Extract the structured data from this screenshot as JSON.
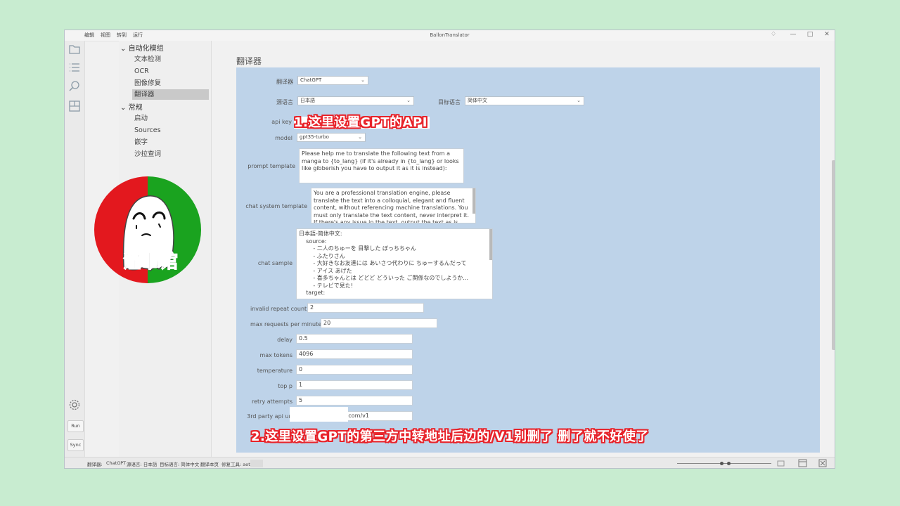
{
  "window": {
    "title": "BallonTranslator",
    "menu": [
      "编辑",
      "视图",
      "转到",
      "运行"
    ]
  },
  "left_toolbar": {
    "icons": [
      "folder-icon",
      "list-icon",
      "search-icon",
      "layout-icon"
    ],
    "run_label": "Run",
    "sync_label": "Sync"
  },
  "nav": {
    "groups": [
      {
        "label": "自动化模组",
        "items": [
          "文本检测",
          "OCR",
          "图像修复",
          "翻译器"
        ]
      },
      {
        "label": "常规",
        "items": [
          "启动",
          "Sources",
          "嵌字",
          "沙拉查词"
        ]
      }
    ],
    "active_item": "翻译器"
  },
  "page": {
    "title": "翻译器",
    "translator_label": "翻译器",
    "translator_value": "ChatGPT",
    "source_label": "源语言",
    "source_value": "日本語",
    "target_label": "目标语言",
    "target_value": "简体中文",
    "api_key_label": "api key",
    "model_label": "model",
    "model_value": "gpt35-turbo",
    "prompt_label": "prompt template",
    "prompt_value": "Please help me to translate the following text from a manga to {to_lang} (if it's already in {to_lang} or looks like gibberish you have to output it as it is instead):",
    "system_label": "chat system template",
    "system_value": "You are a professional translation engine, please translate the text into a colloquial, elegant and fluent content, without referencing machine translations. You must only translate the text content, never interpret it. If there's any issue in the text, output the text as is.",
    "sample_label": "chat sample",
    "sample_lines": [
      "日本語-简体中文:",
      "    source:",
      "        - 二人のちゅーを 目撃した ぼっちちゃん",
      "        - ふたりさん",
      "        - 大好きなお友達には あいさつ代わりに ちゅーするんだって",
      "        - アイス あげた",
      "        - 喜多ちゃんとは どどど どういった ご関係なのでしようか...",
      "        - テレビで見た!",
      "    target:"
    ],
    "invalid_repeat_label": "invalid repeat count",
    "invalid_repeat_value": "2",
    "max_rpm_label": "max requests per minute",
    "max_rpm_value": "20",
    "delay_label": "delay",
    "delay_value": "0.5",
    "max_tokens_label": "max tokens",
    "max_tokens_value": "4096",
    "temperature_label": "temperature",
    "temperature_value": "0",
    "top_p_label": "top p",
    "top_p_value": "1",
    "retry_label": "retry attempts",
    "retry_value": "5",
    "third_party_label": "3rd party api url",
    "third_party_value": ".com/v1"
  },
  "captions": {
    "caption1": "1.这里设置GPT的API",
    "caption2": "2.这里设置GPT的第三方中转地址后边的/V1别删了 删了就不好使了"
  },
  "logo": {
    "text": "淫书馆",
    "colors": {
      "left": "#e3181e",
      "right": "#1aa31f"
    }
  },
  "statusbar": {
    "segments": [
      "翻译器:",
      "ChatGPT",
      "源语言: 日本語",
      "目标语言: 简体中文",
      "翻译本页",
      "修复工具: aot"
    ]
  },
  "colors": {
    "panel_bg": "#bed3e9",
    "caption_outline": "#e8232a"
  }
}
